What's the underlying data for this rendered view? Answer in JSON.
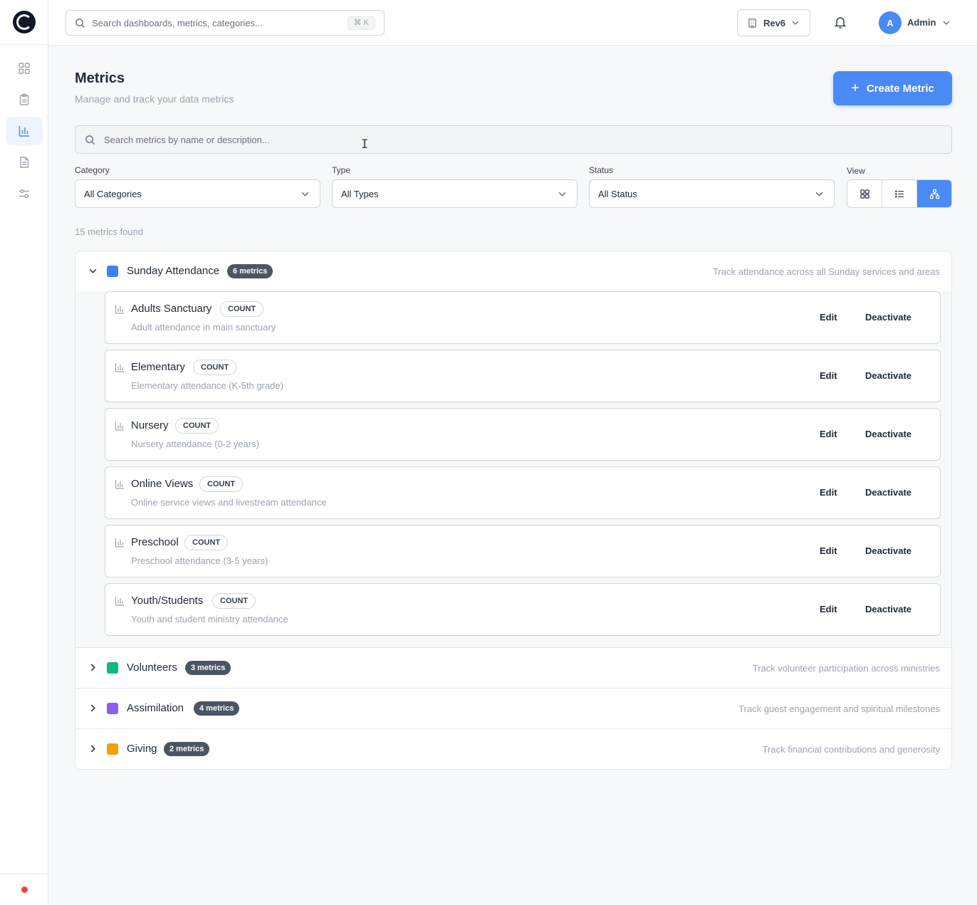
{
  "app": {
    "search_placeholder": "Search dashboards, metrics, categories...",
    "search_shortcut": "⌘ K",
    "org_name": "Rev6",
    "user_initial": "A",
    "user_name": "Admin"
  },
  "sidebar": {
    "items": [
      {
        "icon": "dashboard-grid-icon",
        "active": false
      },
      {
        "icon": "clipboard-icon",
        "active": false
      },
      {
        "icon": "bar-chart-icon",
        "active": true
      },
      {
        "icon": "document-icon",
        "active": false
      },
      {
        "icon": "sliders-icon",
        "active": false
      }
    ],
    "status_color": "#ef4444"
  },
  "page": {
    "title": "Metrics",
    "subtitle": "Manage and track your data metrics",
    "create_label": "Create Metric",
    "search_placeholder": "Search metrics by name or description...",
    "found_text": "15 metrics found"
  },
  "filters": {
    "category_label": "Category",
    "category_value": "All Categories",
    "type_label": "Type",
    "type_value": "All Types",
    "status_label": "Status",
    "status_value": "All Status",
    "view_label": "View",
    "view_active": "tree"
  },
  "colors": {
    "accent": "#4a8af4",
    "sunday": "#3b82f6",
    "volunteers": "#10b981",
    "assimilation": "#8b5cf6",
    "giving": "#f59e0b"
  },
  "groups": [
    {
      "name": "Sunday Attendance",
      "badge": "6 metrics",
      "description": "Track attendance across all Sunday services and areas",
      "expanded": true,
      "metrics": [
        {
          "name": "Adults Sanctuary",
          "type": "COUNT",
          "description": "Adult attendance in main sanctuary"
        },
        {
          "name": "Elementary",
          "type": "COUNT",
          "description": "Elementary attendance (K-5th grade)"
        },
        {
          "name": "Nursery",
          "type": "COUNT",
          "description": "Nursery attendance (0-2 years)"
        },
        {
          "name": "Online Views",
          "type": "COUNT",
          "description": "Online service views and livestream attendance"
        },
        {
          "name": "Preschool",
          "type": "COUNT",
          "description": "Preschool attendance (3-5 years)"
        },
        {
          "name": "Youth/Students",
          "type": "COUNT",
          "description": "Youth and student ministry attendance"
        }
      ]
    },
    {
      "name": "Volunteers",
      "badge": "3 metrics",
      "description": "Track volunteer participation across ministries",
      "expanded": false
    },
    {
      "name": "Assimilation",
      "badge": "4 metrics",
      "description": "Track guest engagement and spiritual milestones",
      "expanded": false
    },
    {
      "name": "Giving",
      "badge": "2 metrics",
      "description": "Track financial contributions and generosity",
      "expanded": false
    }
  ],
  "actions": {
    "edit": "Edit",
    "deactivate": "Deactivate"
  }
}
